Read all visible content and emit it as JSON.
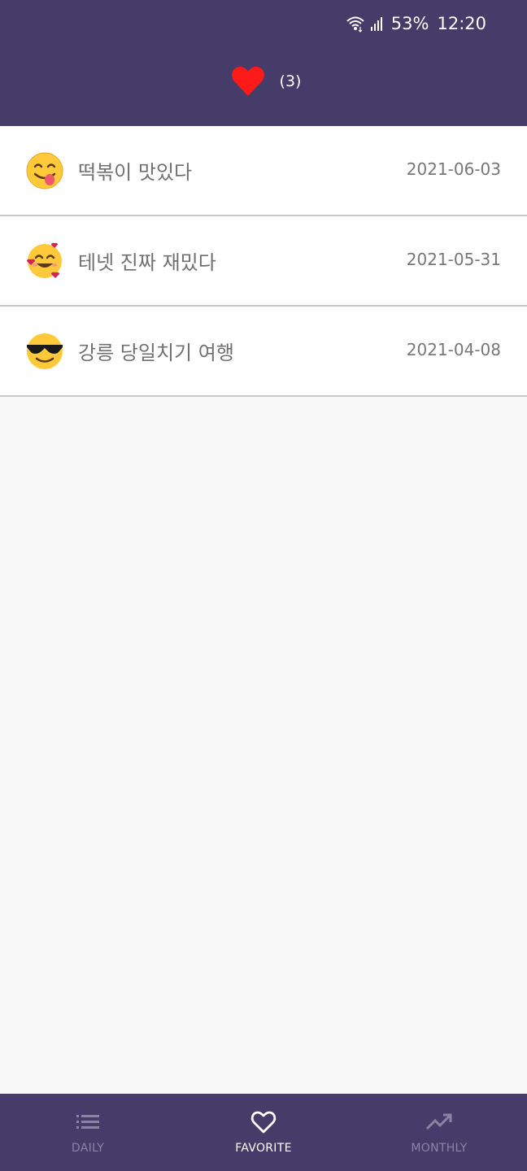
{
  "status_bar": {
    "battery": "53%",
    "time": "12:20"
  },
  "header": {
    "icon": "heart-icon",
    "count": "(3)",
    "accent": "#ff1a1a",
    "background": "#453c6a"
  },
  "entries": [
    {
      "emoji": "face-savoring-food",
      "title": "떡볶이 맛있다",
      "date": "2021-06-03"
    },
    {
      "emoji": "smiling-face-with-hearts",
      "title": "테넷 진짜 재밌다",
      "date": "2021-05-31"
    },
    {
      "emoji": "smiling-face-with-sunglasses",
      "title": "강릉 당일치기 여행",
      "date": "2021-04-08"
    }
  ],
  "nav": {
    "daily": {
      "label": "DAILY",
      "icon": "list-icon"
    },
    "favorite": {
      "label": "FAVORITE",
      "icon": "heart-outline-icon"
    },
    "monthly": {
      "label": "MONTHLY",
      "icon": "trending-up-icon"
    },
    "selected": "FAVORITE"
  }
}
